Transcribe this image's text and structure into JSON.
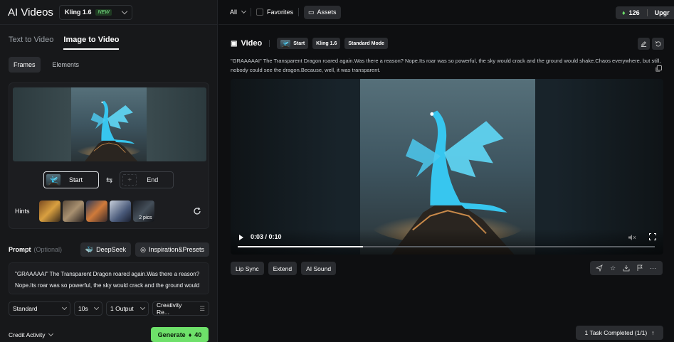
{
  "app": {
    "title": "AI Videos"
  },
  "model_selector": {
    "name": "Kling 1.6",
    "badge": "NEW"
  },
  "mode_tabs": [
    {
      "label": "Text to Video"
    },
    {
      "label": "Image to Video",
      "active": true
    }
  ],
  "sub_tabs": [
    {
      "label": "Frames",
      "active": true
    },
    {
      "label": "Elements"
    }
  ],
  "frames": {
    "start_label": "Start",
    "end_label": "End"
  },
  "hints": {
    "label": "Hints",
    "more_label": "2 pics"
  },
  "prompt": {
    "label": "Prompt",
    "optional": "(Optional)",
    "deepseek_label": "DeepSeek",
    "inspiration_label": "Inspiration&Presets",
    "text": "\"GRAAAAAI\" The Transparent Dragon roared again.Was there a reason? Nope.Its roar was so powerful, the sky would crack and the ground would"
  },
  "settings": {
    "mode": "Standard",
    "duration": "10s",
    "outputs": "1 Output",
    "creativity": "Creativity Re..."
  },
  "credit_activity": "Credit Activity",
  "generate": {
    "label": "Generate",
    "cost": "40"
  },
  "topbar": {
    "filter": "All",
    "favorites": "Favorites",
    "assets": "Assets",
    "credits": "126",
    "upgrade": "Upgr"
  },
  "video": {
    "title": "Video",
    "chip_start": "Start",
    "chip_model": "Kling 1.6",
    "chip_mode": "Standard Mode",
    "description": "\"GRAAAAAI\" The Transparent Dragon roared again.Was there a reason? Nope.Its roar was so powerful, the sky would crack and the ground would shake.Chaos everywhere, but still, nobody could see the dragon.Because, well, it was transparent.",
    "time": "0:03 / 0:10",
    "progress": 0.3
  },
  "actions": [
    {
      "label": "Lip Sync"
    },
    {
      "label": "Extend"
    },
    {
      "label": "AI Sound"
    }
  ],
  "tools": [
    "send-icon",
    "star-icon",
    "download-icon",
    "flag-icon",
    "more-icon"
  ],
  "task_status": "1 Task Completed (1/1)",
  "colors": {
    "accent": "#6ee06a",
    "background": "#0e0f11",
    "panel": "#17181a"
  }
}
